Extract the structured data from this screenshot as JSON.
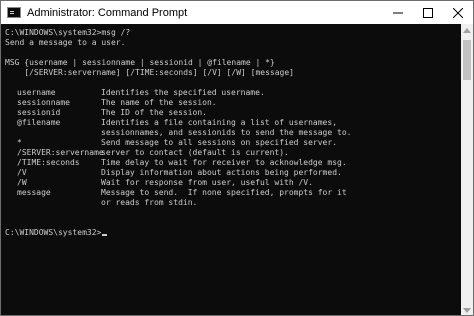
{
  "window": {
    "title": "Administrator: Command Prompt"
  },
  "console": {
    "header_lines": [
      "C:\\WINDOWS\\system32>msg /?",
      "Send a message to a user.",
      "",
      "MSG {username | sessionname | sessionid | @filename | *}",
      "    [/SERVER:servername] [/TIME:seconds] [/V] [/W] [message]",
      ""
    ],
    "options": [
      {
        "name": "username",
        "desc": "Identifies the specified username."
      },
      {
        "name": "sessionname",
        "desc": "The name of the session."
      },
      {
        "name": "sessionid",
        "desc": "The ID of the session."
      },
      {
        "name": "@filename",
        "desc": "Identifies a file containing a list of usernames,"
      },
      {
        "name": "",
        "desc": "sessionnames, and sessionids to send the message to."
      },
      {
        "name": "*",
        "desc": "Send message to all sessions on specified server."
      },
      {
        "name": "/SERVER:servername",
        "desc": "server to contact (default is current)."
      },
      {
        "name": "/TIME:seconds",
        "desc": "Time delay to wait for receiver to acknowledge msg."
      },
      {
        "name": "/V",
        "desc": "Display information about actions being performed."
      },
      {
        "name": "/W",
        "desc": "Wait for response from user, useful with /V."
      },
      {
        "name": "message",
        "desc": "Message to send.  If none specified, prompts for it"
      },
      {
        "name": "",
        "desc": "or reads from stdin."
      }
    ],
    "prompt": "C:\\WINDOWS\\system32>"
  },
  "colors": {
    "console_bg": "#0c0c0c",
    "console_fg": "#cccccc",
    "titlebar_bg": "#ffffff"
  },
  "icons": {
    "app": "console-icon",
    "minimize": "minimize-icon",
    "maximize": "maximize-icon",
    "close": "close-icon"
  }
}
